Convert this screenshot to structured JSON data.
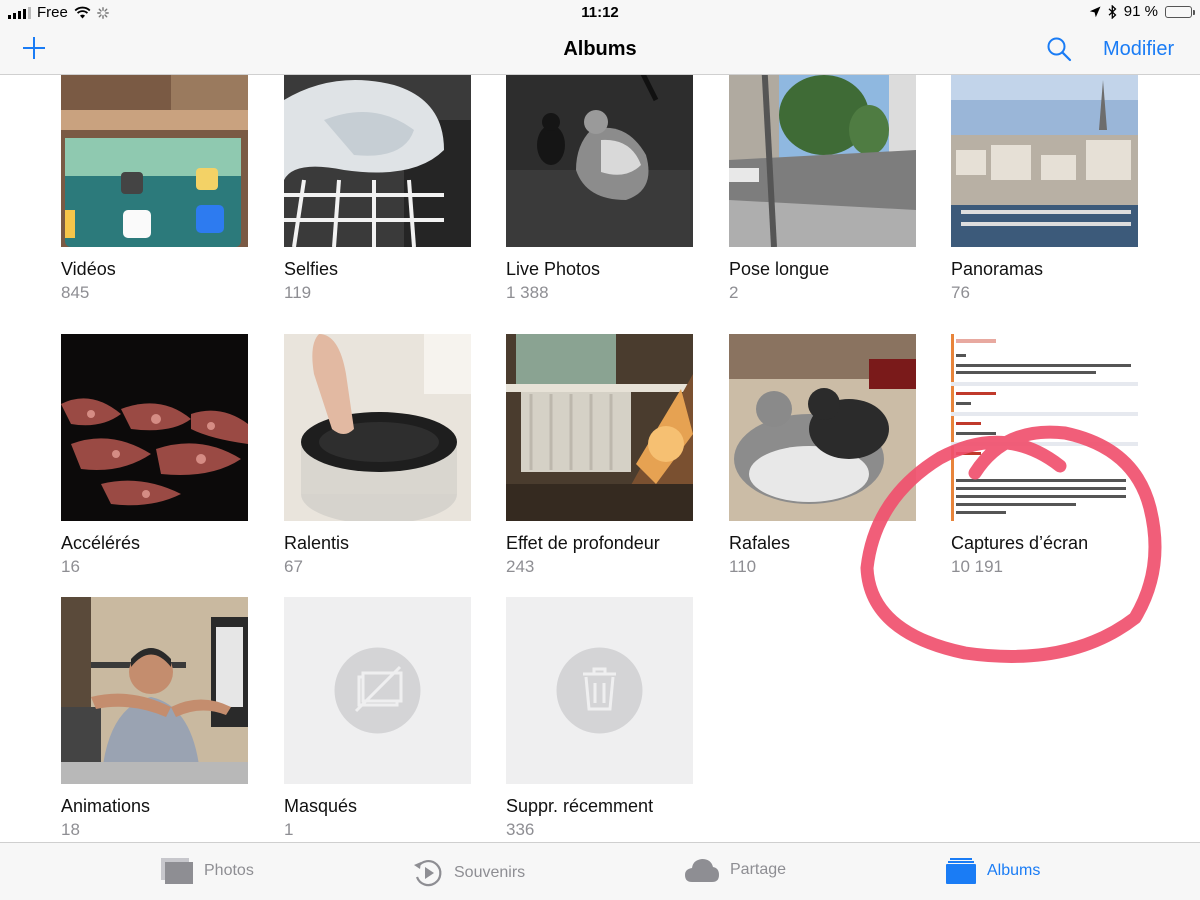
{
  "status_bar": {
    "carrier": "Free",
    "time": "11:12",
    "battery_percent": "91 %",
    "battery_level": 0.91
  },
  "nav": {
    "title": "Albums",
    "edit_label": "Modifier"
  },
  "albums": [
    {
      "name": "Vidéos",
      "count": "845"
    },
    {
      "name": "Selfies",
      "count": "119"
    },
    {
      "name": "Live Photos",
      "count": "1 388"
    },
    {
      "name": "Pose longue",
      "count": "2"
    },
    {
      "name": "Panoramas",
      "count": "76"
    },
    {
      "name": "Accélérés",
      "count": "16"
    },
    {
      "name": "Ralentis",
      "count": "67"
    },
    {
      "name": "Effet de profondeur",
      "count": "243"
    },
    {
      "name": "Rafales",
      "count": "110"
    },
    {
      "name": "Captures d’écran",
      "count": "10 191"
    },
    {
      "name": "Animations",
      "count": "18"
    },
    {
      "name": "Masqués",
      "count": "1"
    },
    {
      "name": "Suppr. récemment",
      "count": "336"
    }
  ],
  "tabs": [
    {
      "label": "Photos",
      "icon": "photos-stack-icon",
      "active": false
    },
    {
      "label": "Souvenirs",
      "icon": "memories-play-icon",
      "active": false
    },
    {
      "label": "Partage",
      "icon": "cloud-icon",
      "active": false
    },
    {
      "label": "Albums",
      "icon": "albums-folder-icon",
      "active": true
    }
  ],
  "colors": {
    "accent": "#1a7cf5",
    "annotation": "#f0506e",
    "secondary_text": "#8e8e93"
  }
}
